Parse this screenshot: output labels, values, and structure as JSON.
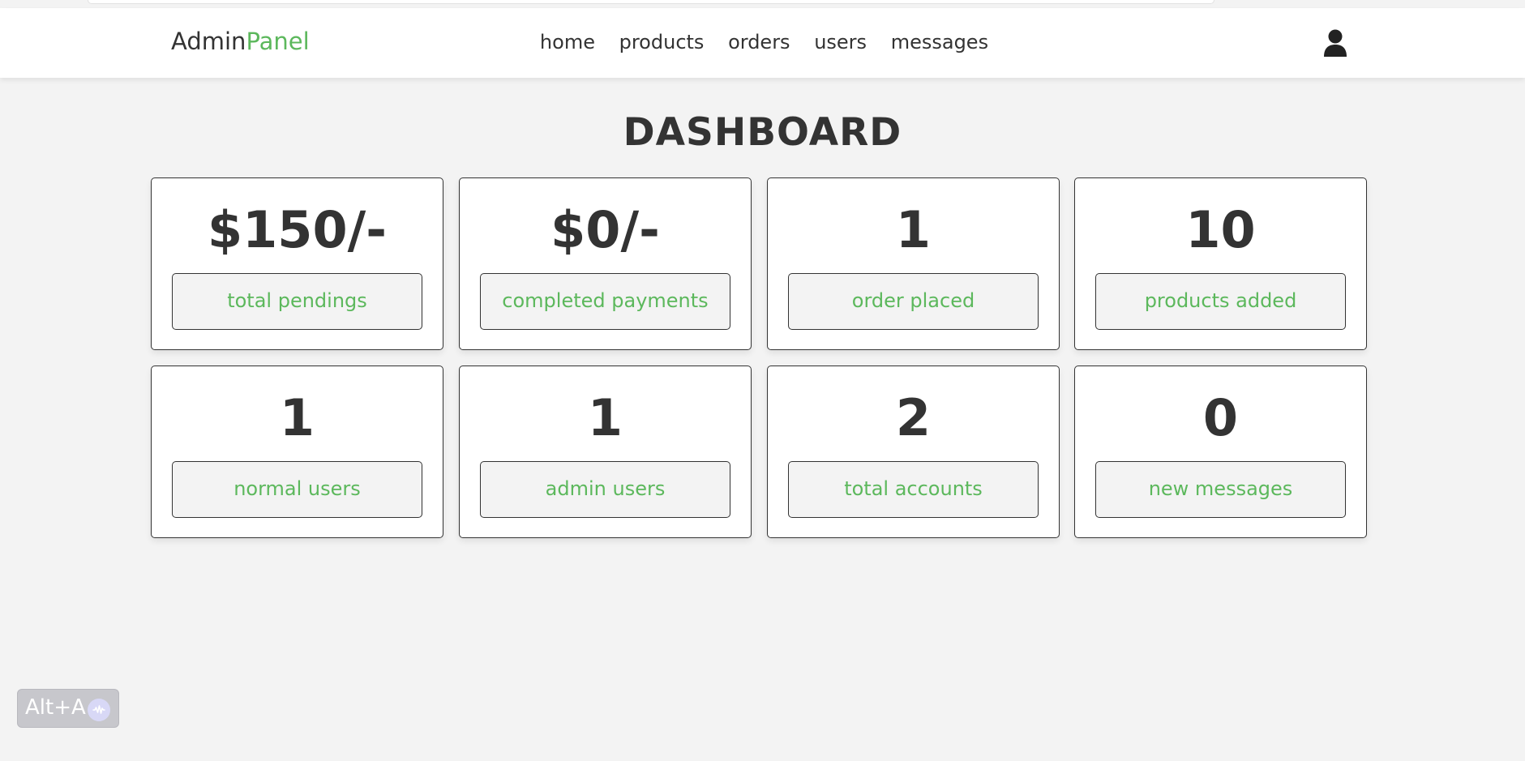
{
  "header": {
    "logo_main": "Admin",
    "logo_accent": "Panel",
    "nav": [
      "home",
      "products",
      "orders",
      "users",
      "messages"
    ],
    "user_icon": "user-icon"
  },
  "page": {
    "title": "DASHBOARD"
  },
  "cards": [
    {
      "value": "$150/-",
      "label": "total pendings"
    },
    {
      "value": "$0/-",
      "label": "completed payments"
    },
    {
      "value": "1",
      "label": "order placed"
    },
    {
      "value": "10",
      "label": "products added"
    },
    {
      "value": "1",
      "label": "normal users"
    },
    {
      "value": "1",
      "label": "admin users"
    },
    {
      "value": "2",
      "label": "total accounts"
    },
    {
      "value": "0",
      "label": "new messages"
    }
  ],
  "widget": {
    "label": "Alt+A",
    "icon": "voice-wave-icon"
  },
  "colors": {
    "accent": "#5cb85c",
    "text": "#333333",
    "background": "#f3f3f3"
  }
}
